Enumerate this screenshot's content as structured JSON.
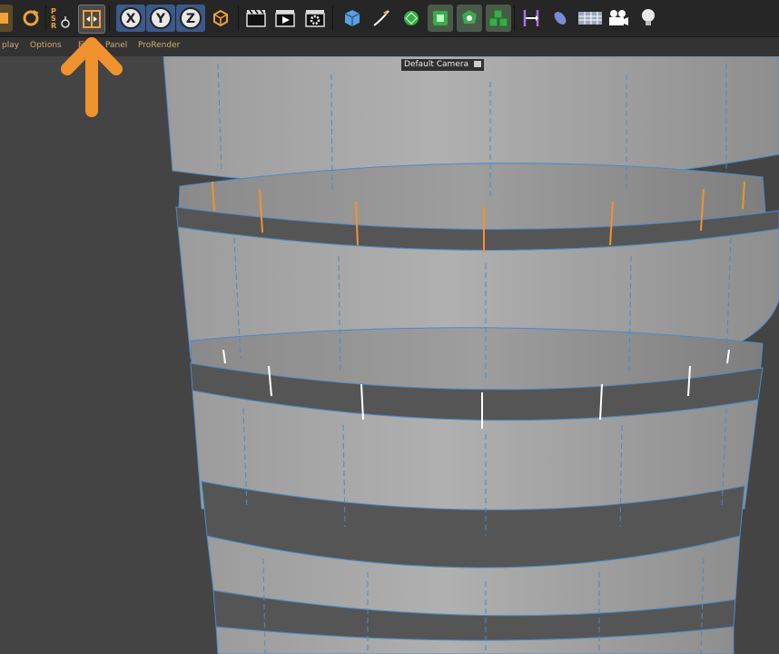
{
  "toolbar": {
    "psr_letters": [
      "P",
      "S",
      "R"
    ],
    "axis_x": "X",
    "axis_y": "Y",
    "axis_z": "Z",
    "icons": [
      "rotate-icon",
      "psr-reset-icon",
      "snap-bounds-icon",
      "axis-x-lock-icon",
      "axis-y-lock-icon",
      "axis-z-lock-icon",
      "coordinate-system-icon",
      "render-view-icon",
      "render-to-picture-viewer-icon",
      "render-settings-icon",
      "cube-primitive-icon",
      "pen-spline-icon",
      "subdivision-surface-icon",
      "array-generator-icon",
      "deformer-icon",
      "mograph-cloner-icon",
      "tag-icon",
      "sketch-icon",
      "floor-icon",
      "camera-icon",
      "light-icon"
    ]
  },
  "menubar": {
    "items": [
      "play",
      "Options",
      "Filter",
      "Panel",
      "ProRender"
    ]
  },
  "viewport": {
    "camera_label": "Default Camera",
    "camera_label_icon": "camera-settings-icon"
  },
  "annotation": {
    "icon": "up-arrow-icon",
    "color": "#f0922e"
  },
  "colors": {
    "toolbar_bg": "#262626",
    "menu_text": "#d4a96a",
    "viewport_bg": "#444444",
    "mesh_face": "#a8a8a8",
    "mesh_edge": "#4a8ac8",
    "selected_edge_orange": "#f0922e",
    "selected_edge_white": "#ffffff"
  }
}
